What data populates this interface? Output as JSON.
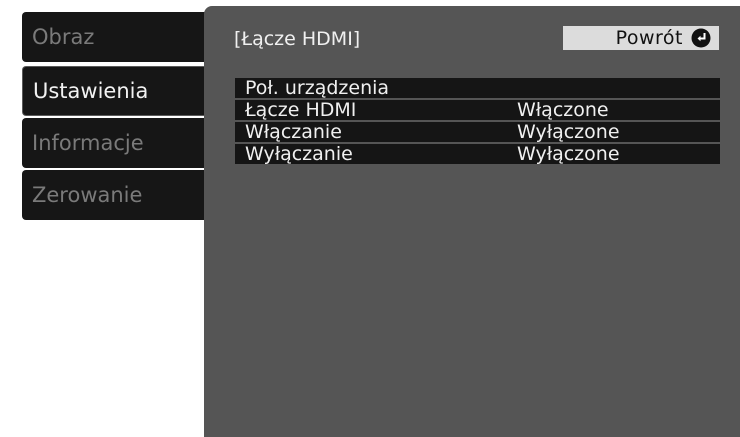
{
  "sidebar": {
    "items": [
      {
        "label": "Obraz"
      },
      {
        "label": "Ustawienia"
      },
      {
        "label": "Informacje"
      },
      {
        "label": "Zerowanie"
      }
    ]
  },
  "panel": {
    "title": "[Łącze HDMI]",
    "back_label": "Powrót",
    "back_icon": "enter-icon"
  },
  "settings": {
    "rows": [
      {
        "label": "Poł. urządzenia",
        "value": ""
      },
      {
        "label": "Łącze HDMI",
        "value": "Włączone"
      },
      {
        "label": "Włączanie",
        "value": "Wyłączone"
      },
      {
        "label": "Wyłączanie",
        "value": "Wyłączone"
      }
    ]
  },
  "colors": {
    "panel_bg": "#555555",
    "row_bg": "#151515",
    "tab_bg": "#161616",
    "button_bg": "#dcdcdc"
  }
}
